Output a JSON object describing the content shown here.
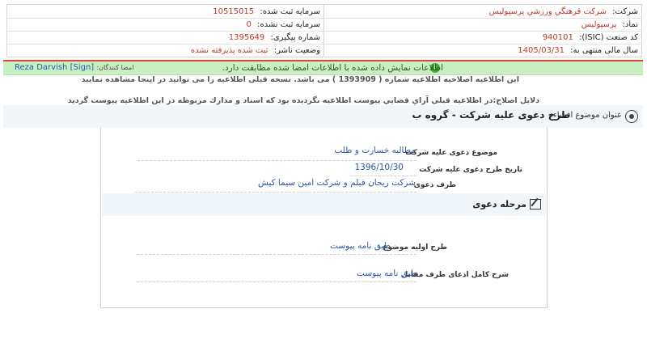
{
  "header": {
    "company_label": "شرکت:",
    "company_value": "شرکت فرهنگي ورزشي پرسپوليس",
    "registered_capital_label": "سرمایه ثبت شده:",
    "registered_capital_value": "10515015",
    "symbol_label": "نماد:",
    "symbol_value": "پرسپولیس",
    "unregistered_capital_label": "سرمایه ثبت نشده:",
    "unregistered_capital_value": "0",
    "isic_label": "کد صنعت (ISIC):",
    "isic_value": "940101",
    "tracking_label": "شماره پیگیری:",
    "tracking_value": "1395649",
    "fiscal_year_label": "سال مالی منتهی به:",
    "fiscal_year_value": "1405/03/31",
    "publisher_status_label": "وضعیت ناشر:",
    "publisher_status_value": "ثبت شده پذیرفته نشده"
  },
  "alert": {
    "text": "اطلاعات نمایش داده شده با اطلاعات امضا شده مطابقت دارد.",
    "signers_label": "امضا کنندگان:",
    "signers_value": "Reza Darvish [Sign]"
  },
  "notes": {
    "correction_notice": "این اطلاعیه اصلاحیه اطلاعیه شماره ( 1393909 ) می باشد. نسخه قبلی اطلاعیه را می توانید در اینجا مشاهده نمایید",
    "correction_reason": "دلایل اصلاح:در اطلاعیه قبلي آراي قضايي پيوست اطلاعيه نگرديده بود كه اسناد و مدارك مربوطه در اين اطلاعيه پيوست گرديد"
  },
  "subject": {
    "label": "عنوان موضوع افشاء:",
    "value": "طرح دعوی علیه شرکت - گروه ب"
  },
  "fields": {
    "claim_subject_label": "موضوع دعوی علیه شرکت",
    "claim_subject_value": "مطالبه خسارت و طلب",
    "claim_date_label": "تاریخ طرح دعوی علیه شرکت",
    "claim_date_value": "1396/10/30",
    "claim_party_label": "طرف دعوی",
    "claim_party_value": "شرکت ریحان فیلم و شرکت امین سیما کیش"
  },
  "stage": {
    "title": "مرحله دعوی",
    "initial_label": "طرح اولیه موضوع",
    "initial_value": "طبق نامه پیوست",
    "full_desc_label": "شرح کامل ادعای طرف مقابل",
    "full_desc_value": "طبق نامه پیوست"
  },
  "colors": {
    "accent_red": "#c0392b",
    "link_blue": "#2b5aa8",
    "alert_green_bg": "#c9efc1"
  }
}
